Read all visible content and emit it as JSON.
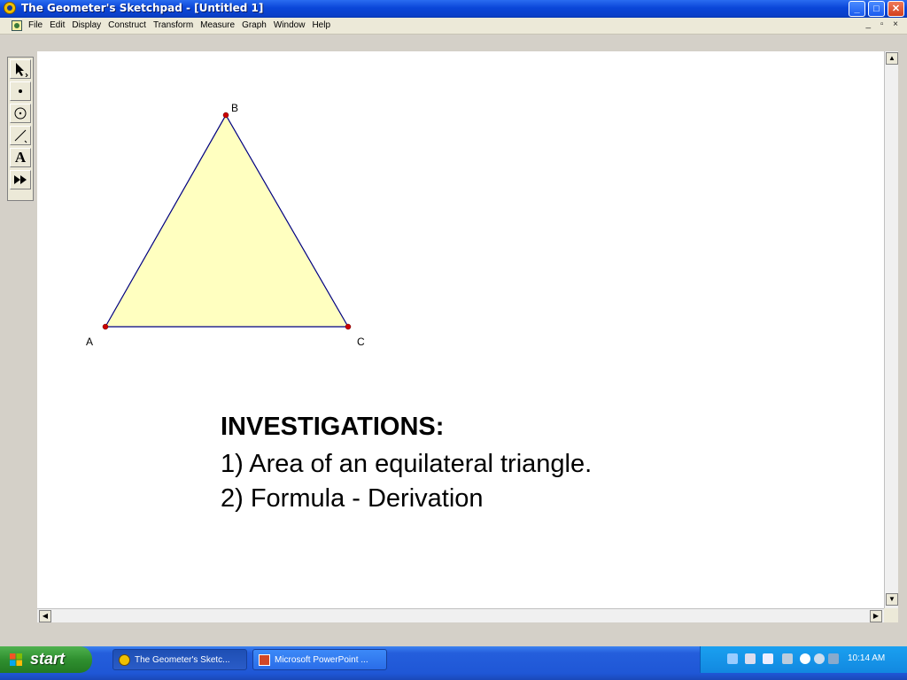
{
  "window": {
    "title": "The Geometer's Sketchpad - [Untitled 1]",
    "controls": {
      "minimize": "_",
      "maximize": "□",
      "close": "✕"
    }
  },
  "menu": {
    "items": [
      "File",
      "Edit",
      "Display",
      "Construct",
      "Transform",
      "Measure",
      "Graph",
      "Window",
      "Help"
    ],
    "mdi_controls": "_ ▫ ×"
  },
  "toolbox": {
    "tools": [
      {
        "name": "selection-arrow-tool",
        "icon": "arrow-icon"
      },
      {
        "name": "point-tool",
        "icon": "point-icon"
      },
      {
        "name": "compass-tool",
        "icon": "circle-icon"
      },
      {
        "name": "straightedge-tool",
        "icon": "segment-icon"
      },
      {
        "name": "text-tool",
        "icon": "text-icon",
        "label": "A"
      },
      {
        "name": "custom-tool",
        "icon": "custom-tool-icon"
      }
    ]
  },
  "sketch": {
    "triangle": {
      "fill": "#ffffc0",
      "stroke": "#000080",
      "point_color": "#cc0000",
      "points": {
        "A": "A",
        "B": "B",
        "C": "C"
      }
    },
    "investigations": {
      "title": "INVESTIGATIONS:",
      "item1": "1) Area of an equilateral triangle.",
      "item2": "2) Formula - Derivation"
    }
  },
  "taskbar": {
    "start_label": "start",
    "tasks": [
      {
        "label": "The Geometer's Sketc...",
        "active": true
      },
      {
        "label": "Microsoft PowerPoint ...",
        "active": false
      }
    ],
    "clock": "10:14 AM"
  },
  "colors": {
    "titlebar": "#0a46d8",
    "start_green": "#2f8f2f",
    "tray_blue": "#1288e0"
  }
}
